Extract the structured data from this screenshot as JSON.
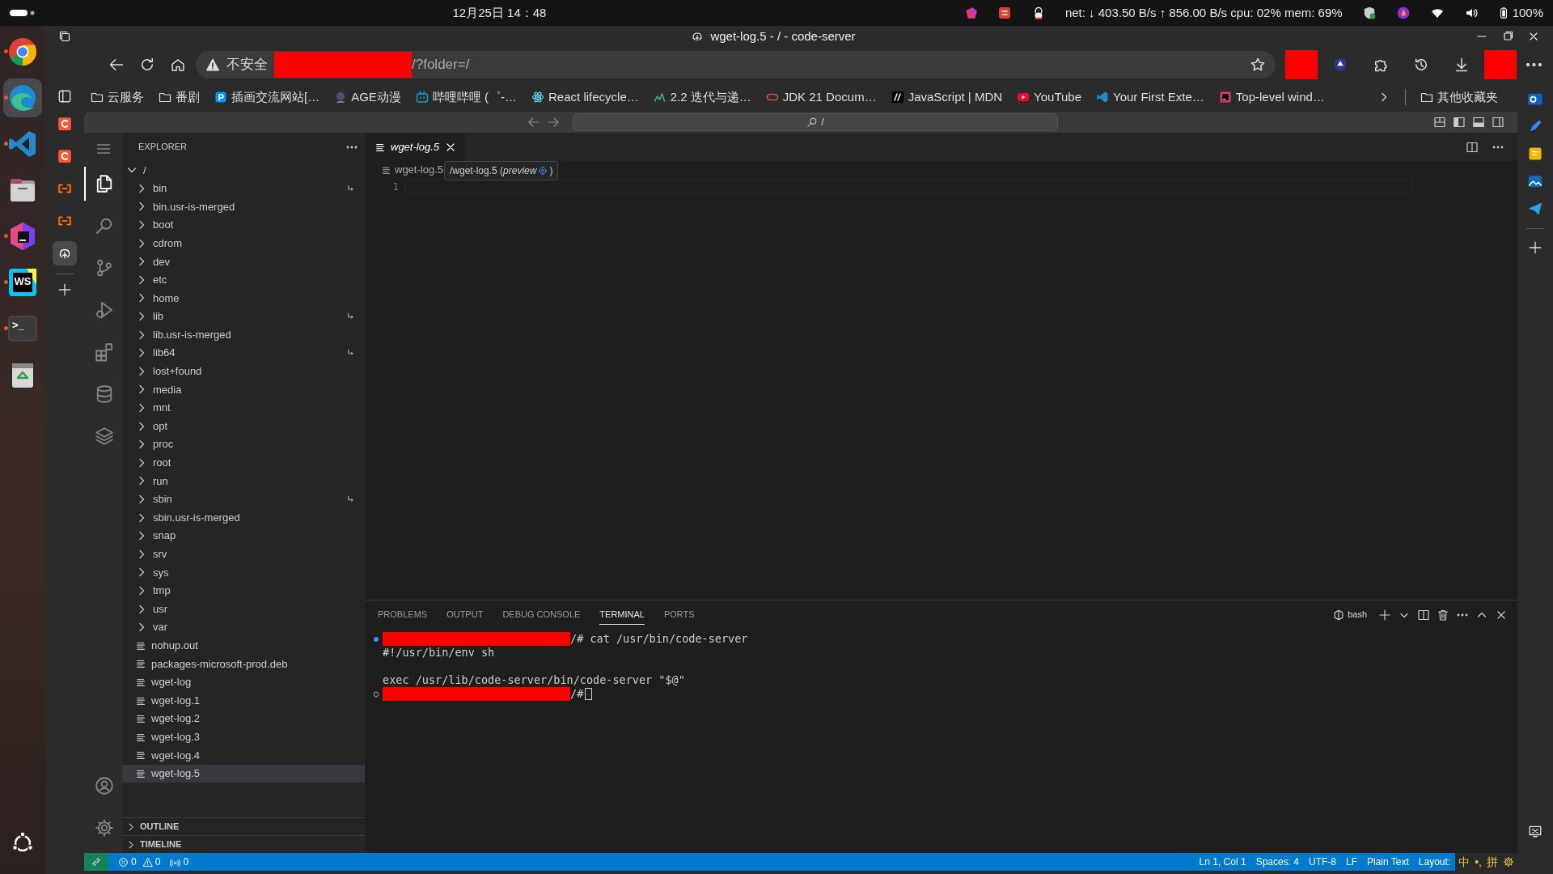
{
  "system_bar": {
    "date_time": "12月25日  14：48",
    "stats": "net: ↓  403.50 B/s ↑  856.00 B/s cpu: 02% mem: 69%",
    "battery": "100%"
  },
  "dock": [
    {
      "kind": "chrome",
      "running": true,
      "selected": false
    },
    {
      "kind": "edge",
      "running": true,
      "selected": true
    },
    {
      "kind": "vscode",
      "running": true,
      "selected": false
    },
    {
      "kind": "files",
      "running": false,
      "selected": false
    },
    {
      "kind": "toolbox",
      "running": true,
      "selected": false
    },
    {
      "kind": "webstorm",
      "label": "WS",
      "running": true,
      "selected": false
    },
    {
      "kind": "terminal",
      "label": ">_",
      "running": true,
      "selected": false
    },
    {
      "kind": "trash",
      "running": false,
      "selected": false
    }
  ],
  "browser": {
    "title": "wget-log.5 - / - code-server",
    "address": {
      "security": "不安全",
      "redacted": true,
      "path": "/?folder=/"
    },
    "bookmarks": [
      {
        "kind": "folder",
        "label": "云服务"
      },
      {
        "kind": "folder",
        "label": "番剧"
      },
      {
        "kind": "pixiv",
        "label": "插画交流网站[…"
      },
      {
        "kind": "avatar",
        "label": "AGE动漫"
      },
      {
        "kind": "bili",
        "label": "哔哩哔哩 (゜-…"
      },
      {
        "kind": "react",
        "label": "React lifecycle…"
      },
      {
        "kind": "chart",
        "label": "2.2  迭代与递…"
      },
      {
        "kind": "oracle",
        "label": "JDK 21 Docum…"
      },
      {
        "kind": "mdn",
        "label": "JavaScript | MDN"
      },
      {
        "kind": "youtube",
        "label": "YouTube"
      },
      {
        "kind": "vscode",
        "label": "Your First Exte…"
      },
      {
        "kind": "jetbrains",
        "label": "Top-level wind…"
      }
    ],
    "other_bookmarks": "其他收藏夹",
    "left_sidebar": [
      {
        "kind": "csdn",
        "selected": false
      },
      {
        "kind": "csdn",
        "selected": false
      },
      {
        "kind": "aliyun",
        "selected": false
      },
      {
        "kind": "aliyun",
        "selected": false
      },
      {
        "kind": "code-server",
        "selected": true
      }
    ],
    "right_sidebar": [
      {
        "kind": "outlook"
      },
      {
        "kind": "pen"
      },
      {
        "kind": "note"
      },
      {
        "kind": "image"
      },
      {
        "kind": "send"
      }
    ]
  },
  "code_server": {
    "command_center": "/",
    "activity_bar": [
      {
        "kind": "explorer",
        "selected": true
      },
      {
        "kind": "search",
        "selected": false
      },
      {
        "kind": "source-control",
        "selected": false
      },
      {
        "kind": "run-debug",
        "selected": false
      },
      {
        "kind": "extensions",
        "selected": false
      },
      {
        "kind": "database",
        "selected": false
      },
      {
        "kind": "layers",
        "selected": false
      }
    ],
    "explorer": {
      "title": "EXPLORER",
      "root": "/",
      "items": [
        {
          "kind": "folder",
          "name": "bin",
          "symlink": true,
          "selected": false
        },
        {
          "kind": "folder",
          "name": "bin.usr-is-merged",
          "symlink": false,
          "selected": false
        },
        {
          "kind": "folder",
          "name": "boot",
          "symlink": false,
          "selected": false
        },
        {
          "kind": "folder",
          "name": "cdrom",
          "symlink": false,
          "selected": false
        },
        {
          "kind": "folder",
          "name": "dev",
          "symlink": false,
          "selected": false
        },
        {
          "kind": "folder",
          "name": "etc",
          "symlink": false,
          "selected": false
        },
        {
          "kind": "folder",
          "name": "home",
          "symlink": false,
          "selected": false
        },
        {
          "kind": "folder",
          "name": "lib",
          "symlink": true,
          "selected": false
        },
        {
          "kind": "folder",
          "name": "lib.usr-is-merged",
          "symlink": false,
          "selected": false
        },
        {
          "kind": "folder",
          "name": "lib64",
          "symlink": true,
          "selected": false
        },
        {
          "kind": "folder",
          "name": "lost+found",
          "symlink": false,
          "selected": false
        },
        {
          "kind": "folder",
          "name": "media",
          "symlink": false,
          "selected": false
        },
        {
          "kind": "folder",
          "name": "mnt",
          "symlink": false,
          "selected": false
        },
        {
          "kind": "folder",
          "name": "opt",
          "symlink": false,
          "selected": false
        },
        {
          "kind": "folder",
          "name": "proc",
          "symlink": false,
          "selected": false
        },
        {
          "kind": "folder",
          "name": "root",
          "symlink": false,
          "selected": false
        },
        {
          "kind": "folder",
          "name": "run",
          "symlink": false,
          "selected": false
        },
        {
          "kind": "folder",
          "name": "sbin",
          "symlink": true,
          "selected": false
        },
        {
          "kind": "folder",
          "name": "sbin.usr-is-merged",
          "symlink": false,
          "selected": false
        },
        {
          "kind": "folder",
          "name": "snap",
          "symlink": false,
          "selected": false
        },
        {
          "kind": "folder",
          "name": "srv",
          "symlink": false,
          "selected": false
        },
        {
          "kind": "folder",
          "name": "sys",
          "symlink": false,
          "selected": false
        },
        {
          "kind": "folder",
          "name": "tmp",
          "symlink": false,
          "selected": false
        },
        {
          "kind": "folder",
          "name": "usr",
          "symlink": false,
          "selected": false
        },
        {
          "kind": "folder",
          "name": "var",
          "symlink": false,
          "selected": false
        },
        {
          "kind": "file",
          "name": "nohup.out",
          "selected": false
        },
        {
          "kind": "file",
          "name": "packages-microsoft-prod.deb",
          "selected": false
        },
        {
          "kind": "file",
          "name": "wget-log",
          "selected": false
        },
        {
          "kind": "file",
          "name": "wget-log.1",
          "selected": false
        },
        {
          "kind": "file",
          "name": "wget-log.2",
          "selected": false
        },
        {
          "kind": "file",
          "name": "wget-log.3",
          "selected": false
        },
        {
          "kind": "file",
          "name": "wget-log.4",
          "selected": false
        },
        {
          "kind": "file",
          "name": "wget-log.5",
          "selected": true
        }
      ],
      "sections": [
        {
          "title": "OUTLINE",
          "expanded": false
        },
        {
          "title": "TIMELINE",
          "expanded": false
        }
      ]
    },
    "editor": {
      "tabs": [
        {
          "label": "wget-log.5",
          "preview": true,
          "selected": true
        }
      ],
      "breadcrumb": "wget-log.5",
      "tooltip": {
        "text": "/wget-log.5 (*preview*",
        "close": ")"
      },
      "line_numbers": [
        "1"
      ]
    },
    "panel": {
      "tabs": [
        {
          "label": "PROBLEMS",
          "selected": false
        },
        {
          "label": "OUTPUT",
          "selected": false
        },
        {
          "label": "DEBUG CONSOLE",
          "selected": false
        },
        {
          "label": "TERMINAL",
          "selected": true
        },
        {
          "label": "PORTS",
          "selected": false
        }
      ],
      "shell": "bash",
      "lines": [
        {
          "kind": "prompt",
          "completed": true,
          "redacted": true,
          "text": "/# cat /usr/bin/code-server",
          "cursor": false
        },
        {
          "kind": "output",
          "text": "#!/usr/bin/env sh"
        },
        {
          "kind": "blank"
        },
        {
          "kind": "output",
          "text": "exec /usr/lib/code-server/bin/code-server \"$@\""
        },
        {
          "kind": "prompt",
          "completed": false,
          "redacted": true,
          "text": "/#",
          "cursor": true
        }
      ]
    },
    "status_bar": {
      "errors": "0",
      "warnings": "0",
      "ports": "0",
      "right": [
        "Ln 1, Col 1",
        "Spaces: 4",
        "UTF-8",
        "LF",
        "Plain Text",
        "Layout:"
      ],
      "tray": [
        "中",
        "•,",
        "拼"
      ]
    }
  }
}
